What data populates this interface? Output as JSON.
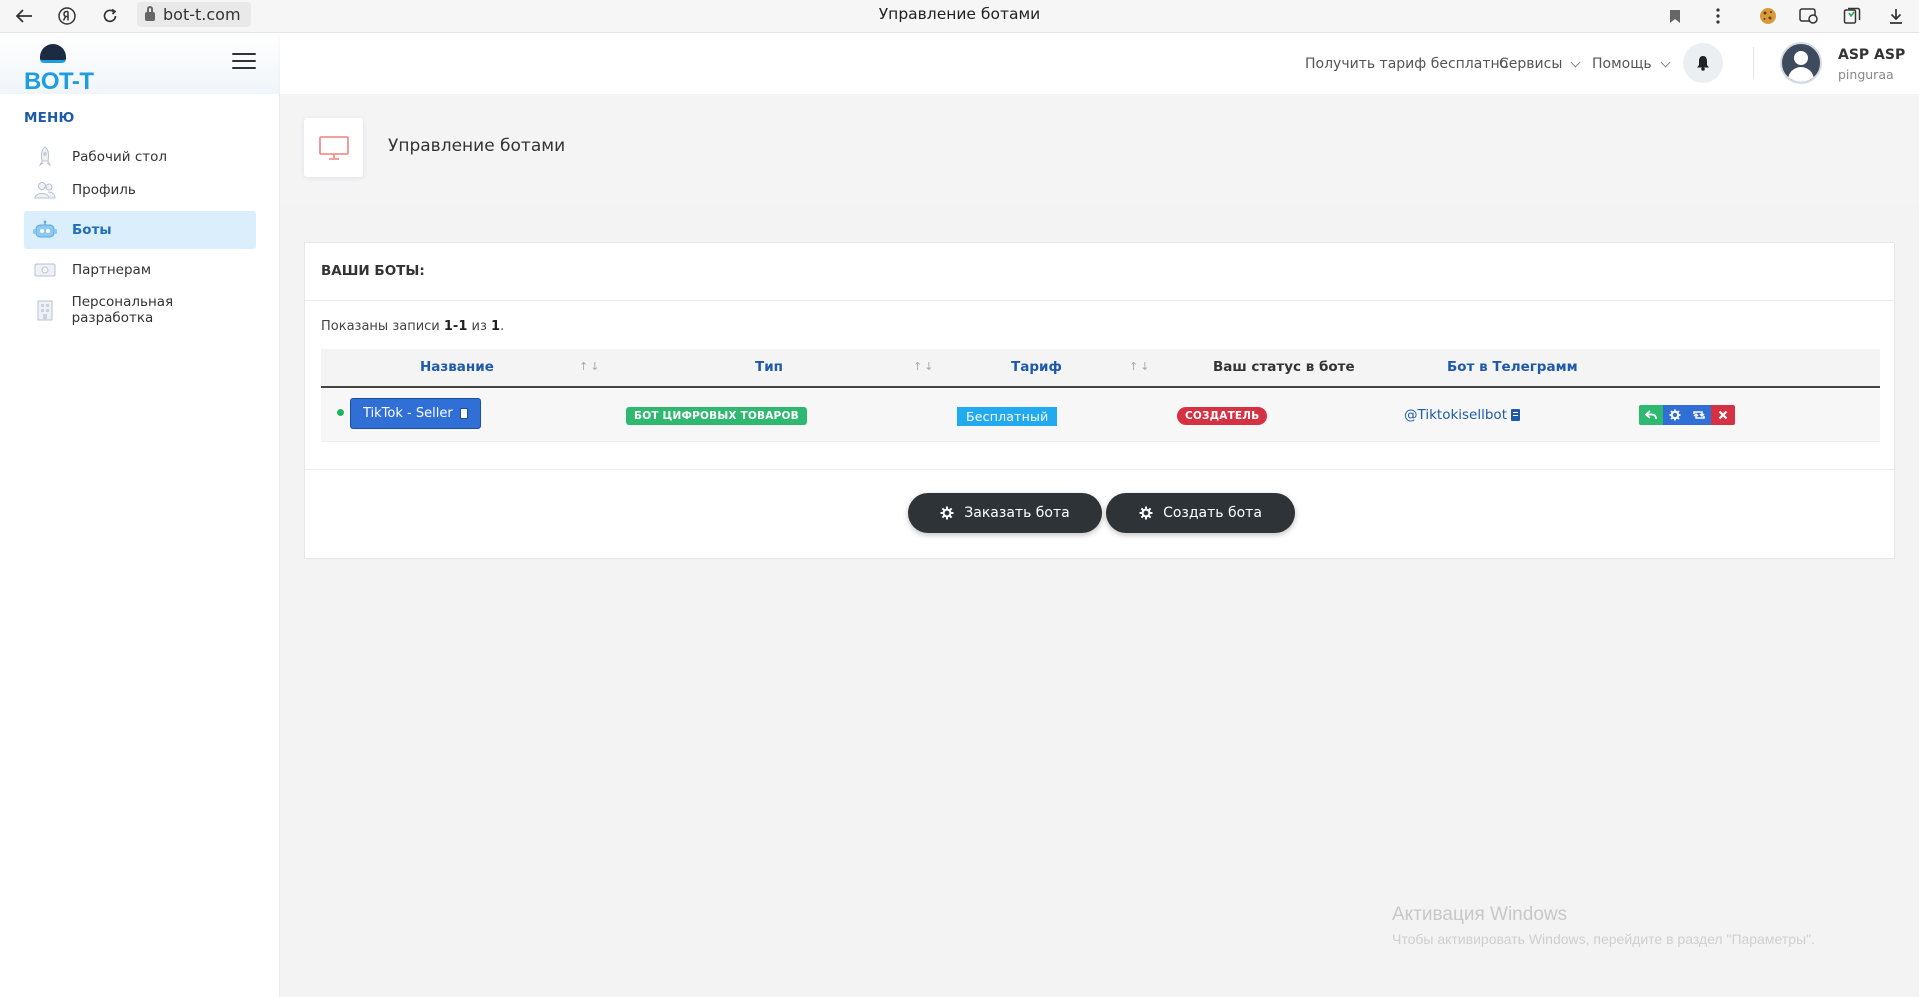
{
  "browser": {
    "url": "bot-t.com",
    "title": "Управление ботами"
  },
  "sidebar": {
    "logo_text": "BOT-T",
    "menu_label": "МЕНЮ",
    "items": [
      {
        "label": "Рабочий стол",
        "icon": "rocket-icon",
        "active": false
      },
      {
        "label": "Профиль",
        "icon": "users-icon",
        "active": false
      },
      {
        "label": "Боты",
        "icon": "robot-icon",
        "active": true
      },
      {
        "label": "Партнерам",
        "icon": "money-icon",
        "active": false
      },
      {
        "label": "Персональная разработка",
        "icon": "building-icon",
        "active": false
      }
    ]
  },
  "header": {
    "links": [
      {
        "label": "Получить тариф бесплатно",
        "dropdown": false
      },
      {
        "label": "Сервисы",
        "dropdown": true
      },
      {
        "label": "Помощь",
        "dropdown": true
      }
    ],
    "user": {
      "name": "ASP ASP",
      "login": "pinguraa"
    }
  },
  "page": {
    "title": "Управление ботами",
    "icon": "monitor-icon"
  },
  "card": {
    "title": "ВАШИ БОТЫ:",
    "records_prefix": "Показаны записи",
    "records_range": "1-1",
    "records_of": "из",
    "records_total": "1",
    "records_suffix": ".",
    "columns": [
      "Название",
      "Тип",
      "Тариф",
      "Ваш статус в боте",
      "Бот в Телеграмм"
    ],
    "rows": [
      {
        "online": true,
        "name": "TikTok - Seller",
        "type": "БОТ ЦИФРОВЫХ ТОВАРОВ",
        "tariff": "Бесплатный",
        "status": "СОЗДАТЕЛЬ",
        "telegram": "@Tiktokisellbot",
        "actions": [
          "reply-icon",
          "gear-icon",
          "retweet-icon",
          "close-icon"
        ]
      }
    ],
    "order_button": "Заказать бота",
    "create_button": "Создать бота"
  },
  "watermark": {
    "title": "Активация Windows",
    "subtitle": "Чтобы активировать Windows, перейдите в раздел \"Параметры\"."
  },
  "colors": {
    "primary": "#2f6fd6",
    "success": "#2fb86f",
    "danger": "#d63143",
    "info": "#22aaf0",
    "link": "#1e5aa8",
    "dark_button": "#2e3338"
  }
}
